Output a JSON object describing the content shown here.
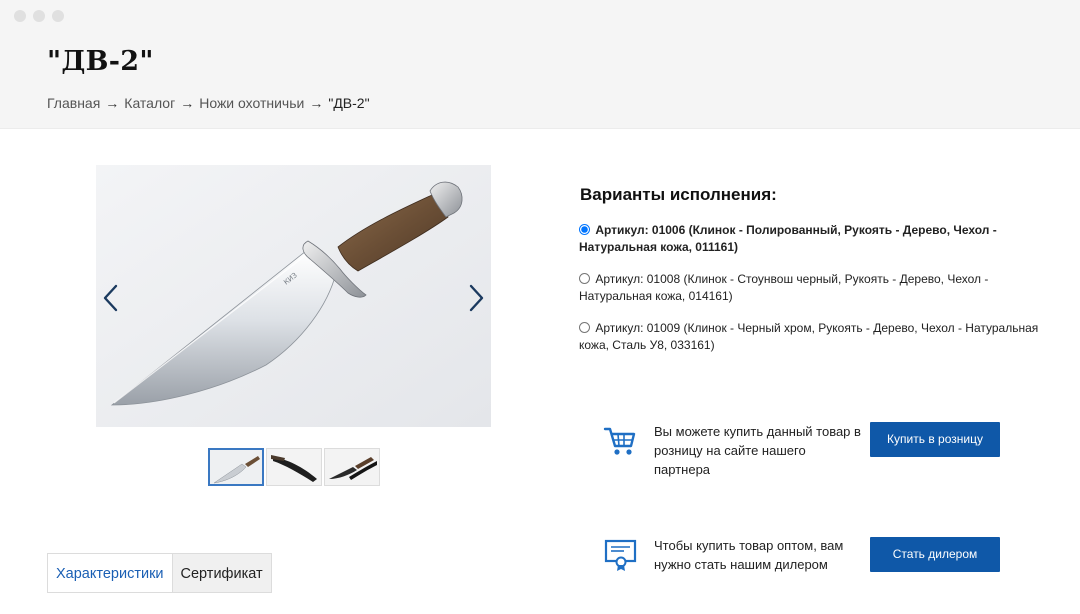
{
  "page": {
    "title": "\"ДВ-2\""
  },
  "breadcrumb": {
    "items": [
      "Главная",
      "Каталог",
      "Ножи охотничьи",
      "\"ДВ-2\""
    ],
    "separator": "→"
  },
  "gallery": {
    "thumbnails": [
      "knife-polished",
      "knife-black-sheath",
      "knife-black-chrome"
    ],
    "active_index": 0
  },
  "variants": {
    "title": "Варианты исполнения:",
    "items": [
      {
        "label": "Артикул: 01006 (Клинок - Полированный, Рукоять - Дерево, Чехол - Натуральная кожа, 011161)",
        "checked": true
      },
      {
        "label": "Артикул: 01008 (Клинок - Стоунвош черный, Рукоять - Дерево, Чехол - Натуральная кожа, 014161)",
        "checked": false
      },
      {
        "label": "Артикул: 01009 (Клинок - Черный хром, Рукоять - Дерево, Чехол - Натуральная кожа, Сталь У8, 033161)",
        "checked": false
      }
    ]
  },
  "actions": {
    "retail": {
      "icon": "shopping-cart-icon",
      "text": "Вы можете купить данный товар в розницу на сайте нашего партнера",
      "button": "Купить в розницу"
    },
    "dealer": {
      "icon": "certificate-icon",
      "text": "Чтобы купить товар оптом, вам нужно стать нашим дилером",
      "button": "Стать дилером"
    }
  },
  "tabs": [
    "Характеристики",
    "Сертификат"
  ],
  "colors": {
    "accent": "#0f58a8",
    "icon": "#1f6fc4",
    "link_active": "#1a5fb4",
    "header_bg": "#f5f5f5"
  }
}
